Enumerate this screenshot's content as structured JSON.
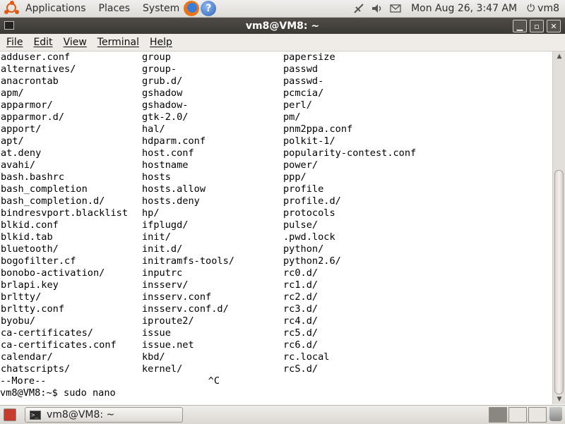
{
  "top_panel": {
    "menus": [
      "Applications",
      "Places",
      "System"
    ],
    "clock": "Mon Aug 26,  3:47 AM",
    "user": "vm8"
  },
  "window": {
    "title": "vm8@VM8: ~",
    "buttons": {
      "minimize": "▁",
      "maximize": "▫",
      "close": "✕"
    }
  },
  "menubar": [
    "File",
    "Edit",
    "View",
    "Terminal",
    "Help"
  ],
  "terminal": {
    "rows": [
      [
        "adduser.conf",
        "group",
        "papersize"
      ],
      [
        "alternatives/",
        "group-",
        "passwd"
      ],
      [
        "anacrontab",
        "grub.d/",
        "passwd-"
      ],
      [
        "apm/",
        "gshadow",
        "pcmcia/"
      ],
      [
        "apparmor/",
        "gshadow-",
        "perl/"
      ],
      [
        "apparmor.d/",
        "gtk-2.0/",
        "pm/"
      ],
      [
        "apport/",
        "hal/",
        "pnm2ppa.conf"
      ],
      [
        "apt/",
        "hdparm.conf",
        "polkit-1/"
      ],
      [
        "at.deny",
        "host.conf",
        "popularity-contest.conf"
      ],
      [
        "avahi/",
        "hostname",
        "power/"
      ],
      [
        "bash.bashrc",
        "hosts",
        "ppp/"
      ],
      [
        "bash_completion",
        "hosts.allow",
        "profile"
      ],
      [
        "bash_completion.d/",
        "hosts.deny",
        "profile.d/"
      ],
      [
        "bindresvport.blacklist",
        "hp/",
        "protocols"
      ],
      [
        "blkid.conf",
        "ifplugd/",
        "pulse/"
      ],
      [
        "blkid.tab",
        "init/",
        ".pwd.lock"
      ],
      [
        "bluetooth/",
        "init.d/",
        "python/"
      ],
      [
        "bogofilter.cf",
        "initramfs-tools/",
        "python2.6/"
      ],
      [
        "bonobo-activation/",
        "inputrc",
        "rc0.d/"
      ],
      [
        "brlapi.key",
        "insserv/",
        "rc1.d/"
      ],
      [
        "brltty/",
        "insserv.conf",
        "rc2.d/"
      ],
      [
        "brltty.conf",
        "insserv.conf.d/",
        "rc3.d/"
      ],
      [
        "byobu/",
        "iproute2/",
        "rc4.d/"
      ],
      [
        "ca-certificates/",
        "issue",
        "rc5.d/"
      ],
      [
        "ca-certificates.conf",
        "issue.net",
        "rc6.d/"
      ],
      [
        "calendar/",
        "kbd/",
        "rc.local"
      ],
      [
        "chatscripts/",
        "kernel/",
        "rcS.d/"
      ]
    ],
    "more_line": "--More--                            ^C",
    "prompt_line": "vm8@VM8:~$ sudo nano"
  },
  "taskbar": {
    "task_label": "vm8@VM8: ~"
  }
}
